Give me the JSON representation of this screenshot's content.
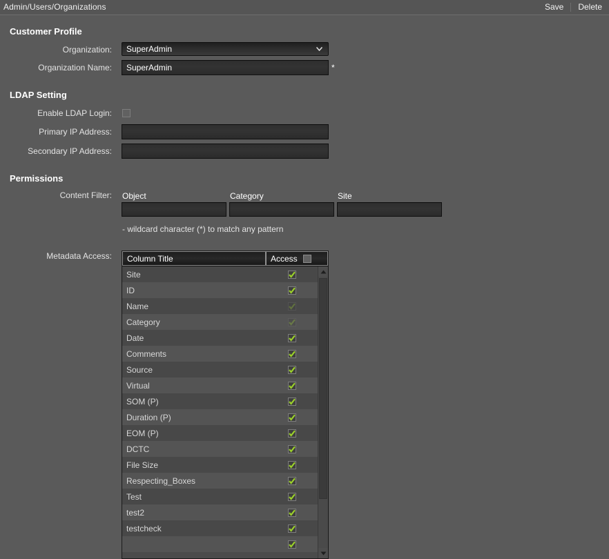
{
  "topbar": {
    "breadcrumb": "Admin/Users/Organizations",
    "save_label": "Save",
    "delete_label": "Delete"
  },
  "customer_profile": {
    "heading": "Customer Profile",
    "organization_label": "Organization:",
    "organization_value": "SuperAdmin",
    "organization_name_label": "Organization Name:",
    "organization_name_value": "SuperAdmin",
    "required_marker": "*"
  },
  "ldap": {
    "heading": "LDAP Setting",
    "enable_label": "Enable LDAP Login:",
    "enable_checked": false,
    "primary_ip_label": "Primary IP Address:",
    "primary_ip_value": "",
    "secondary_ip_label": "Secondary IP Address:",
    "secondary_ip_value": ""
  },
  "permissions": {
    "heading": "Permissions",
    "content_filter_label": "Content Filter:",
    "filters": [
      {
        "header": "Object",
        "value": ""
      },
      {
        "header": "Category",
        "value": ""
      },
      {
        "header": "Site",
        "value": ""
      }
    ],
    "hint": "- wildcard character (*) to match any pattern"
  },
  "metadata_access": {
    "label": "Metadata Access:",
    "columns": {
      "title": "Column Title",
      "access": "Access"
    },
    "header_checkbox_checked": false,
    "rows": [
      {
        "name": "Site",
        "access": true,
        "enabled": true
      },
      {
        "name": "ID",
        "access": true,
        "enabled": true
      },
      {
        "name": "Name",
        "access": true,
        "enabled": false
      },
      {
        "name": "Category",
        "access": true,
        "enabled": false
      },
      {
        "name": "Date",
        "access": true,
        "enabled": true
      },
      {
        "name": "Comments",
        "access": true,
        "enabled": true
      },
      {
        "name": "Source",
        "access": true,
        "enabled": true
      },
      {
        "name": "Virtual",
        "access": true,
        "enabled": true
      },
      {
        "name": "SOM (P)",
        "access": true,
        "enabled": true
      },
      {
        "name": "Duration (P)",
        "access": true,
        "enabled": true
      },
      {
        "name": "EOM (P)",
        "access": true,
        "enabled": true
      },
      {
        "name": "DCTC",
        "access": true,
        "enabled": true
      },
      {
        "name": "File Size",
        "access": true,
        "enabled": true
      },
      {
        "name": "Respecting_Boxes",
        "access": true,
        "enabled": true
      },
      {
        "name": "Test",
        "access": true,
        "enabled": true
      },
      {
        "name": "test2",
        "access": true,
        "enabled": true
      },
      {
        "name": "testcheck",
        "access": true,
        "enabled": true
      },
      {
        "name": "",
        "access": true,
        "enabled": true
      }
    ],
    "scroll_up_icon": "triangle-up-icon",
    "scroll_down_icon": "triangle-down-icon"
  },
  "colors": {
    "background": "#5a5a5a",
    "topbar": "#555555",
    "input_dark": "#2f2f2f",
    "check_green": "#9bd02b",
    "row_even": "#484848",
    "row_odd": "#545454"
  }
}
